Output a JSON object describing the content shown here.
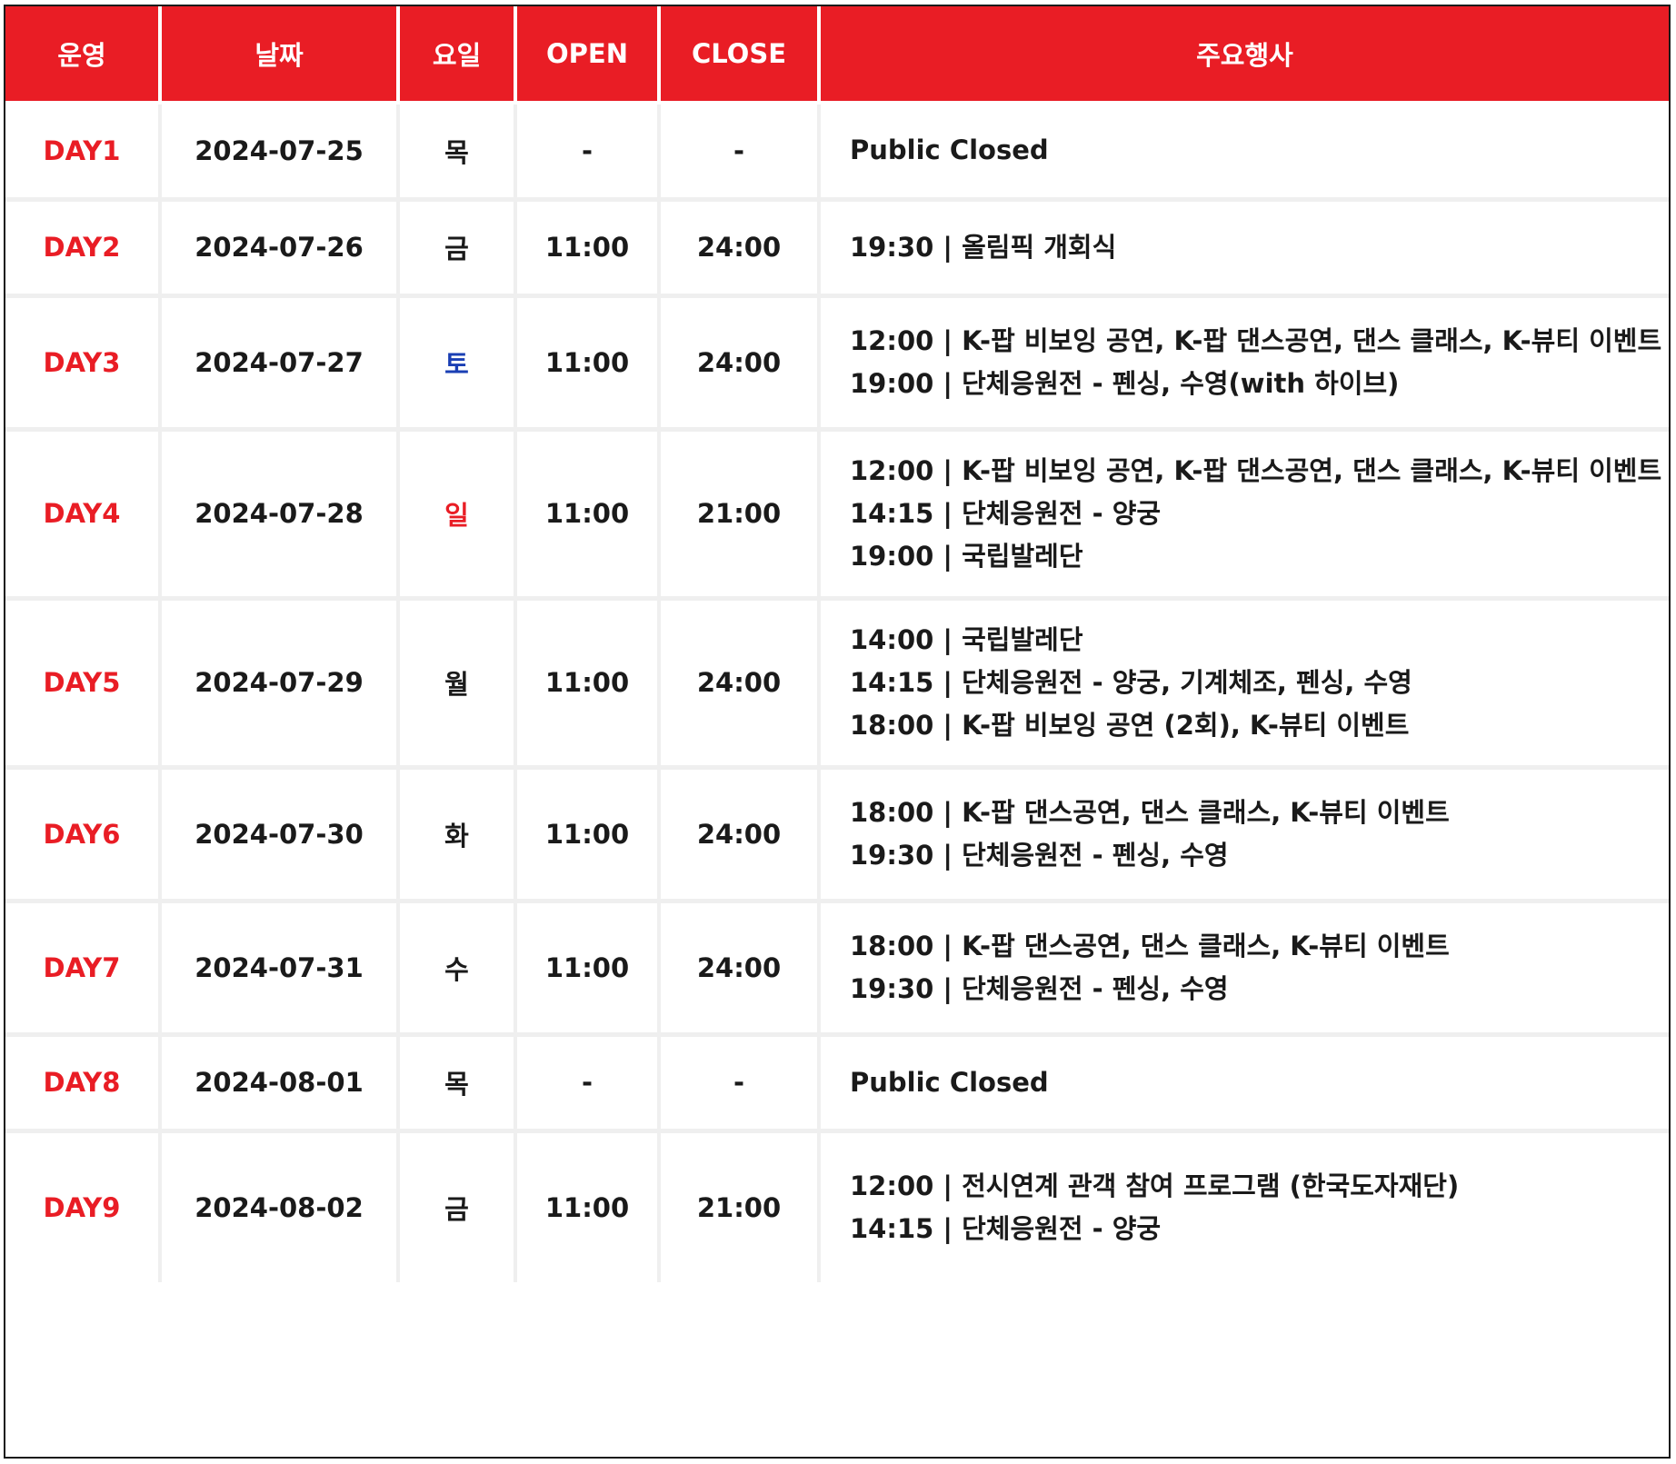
{
  "headers": {
    "operation": "운영",
    "date": "날짜",
    "weekday": "요일",
    "open": "OPEN",
    "close": "CLOSE",
    "events": "주요행사"
  },
  "colors": {
    "header_bg": "#e91d25",
    "day_label": "#e91d25",
    "saturday": "#1a3fb4",
    "sunday": "#e91d25"
  },
  "rows": [
    {
      "day": "DAY1",
      "date": "2024-07-25",
      "weekday": "목",
      "open": "-",
      "close": "-",
      "events": [
        "Public Closed"
      ]
    },
    {
      "day": "DAY2",
      "date": "2024-07-26",
      "weekday": "금",
      "open": "11:00",
      "close": "24:00",
      "events": [
        "19:30 | 올림픽 개회식"
      ]
    },
    {
      "day": "DAY3",
      "date": "2024-07-27",
      "weekday": "토",
      "open": "11:00",
      "close": "24:00",
      "events": [
        "12:00 | K-팝 비보잉 공연, K-팝 댄스공연, 댄스 클래스, K-뷰티 이벤트",
        "19:00 | 단체응원전 - 펜싱, 수영(with 하이브)"
      ]
    },
    {
      "day": "DAY4",
      "date": "2024-07-28",
      "weekday": "일",
      "open": "11:00",
      "close": "21:00",
      "events": [
        "12:00 | K-팝 비보잉 공연, K-팝 댄스공연, 댄스 클래스, K-뷰티 이벤트",
        "14:15 | 단체응원전 - 양궁",
        "19:00 | 국립발레단"
      ]
    },
    {
      "day": "DAY5",
      "date": "2024-07-29",
      "weekday": "월",
      "open": "11:00",
      "close": "24:00",
      "events": [
        "14:00 | 국립발레단",
        "14:15 | 단체응원전 - 양궁, 기계체조, 펜싱, 수영",
        "18:00 | K-팝 비보잉 공연 (2회), K-뷰티 이벤트"
      ]
    },
    {
      "day": "DAY6",
      "date": "2024-07-30",
      "weekday": "화",
      "open": "11:00",
      "close": "24:00",
      "events": [
        "18:00 | K-팝 댄스공연, 댄스 클래스, K-뷰티 이벤트",
        "19:30 | 단체응원전 - 펜싱, 수영"
      ]
    },
    {
      "day": "DAY7",
      "date": "2024-07-31",
      "weekday": "수",
      "open": "11:00",
      "close": "24:00",
      "events": [
        "18:00 | K-팝 댄스공연, 댄스 클래스, K-뷰티 이벤트",
        "19:30 | 단체응원전 - 펜싱, 수영"
      ]
    },
    {
      "day": "DAY8",
      "date": "2024-08-01",
      "weekday": "목",
      "open": "-",
      "close": "-",
      "events": [
        "Public Closed"
      ]
    },
    {
      "day": "DAY9",
      "date": "2024-08-02",
      "weekday": "금",
      "open": "11:00",
      "close": "21:00",
      "events": [
        "12:00 | 전시연계 관객 참여 프로그램 (한국도자재단)",
        "14:15 | 단체응원전 - 양궁"
      ]
    }
  ]
}
